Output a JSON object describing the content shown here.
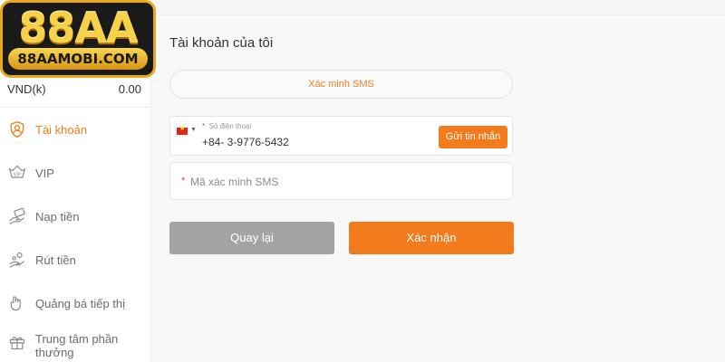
{
  "logo": {
    "brand_top": "88AA",
    "brand_bottom": "88AAMOBI.COM"
  },
  "balance": {
    "currency": "VND(k)",
    "amount": "0.00"
  },
  "menu": [
    {
      "label": "Tài khoản",
      "icon": "user-shield-icon",
      "active": true
    },
    {
      "label": "VIP",
      "icon": "vip-badge-icon",
      "active": false
    },
    {
      "label": "Nạp tiền",
      "icon": "deposit-hand-icon",
      "active": false
    },
    {
      "label": "Rút tiền",
      "icon": "withdraw-hand-icon",
      "active": false
    },
    {
      "label": "Quảng bá tiếp thị",
      "icon": "promotion-icon",
      "active": false
    },
    {
      "label": "Trung tâm phần thưởng",
      "icon": "gift-icon",
      "active": false
    }
  ],
  "page": {
    "title": "Tài khoản của tôi"
  },
  "tab": {
    "label": "Xác minh SMS"
  },
  "phone": {
    "label": "Số điện thoại",
    "value": "+84- 3-9776-5432",
    "country": "Vietnam"
  },
  "send_button": {
    "label": "Gửi tin nhắn"
  },
  "code": {
    "placeholder": "Mã xác minh SMS",
    "value": ""
  },
  "actions": {
    "back": "Quay lại",
    "confirm": "Xác nhận"
  },
  "colors": {
    "accent": "#f27b1d",
    "muted_button": "#a3a3a3",
    "logo_gold": "#f6d24a"
  }
}
